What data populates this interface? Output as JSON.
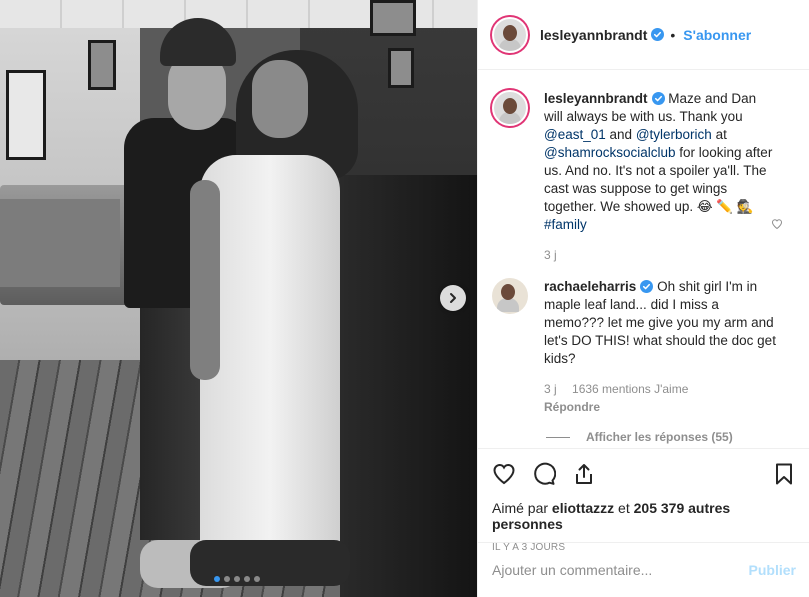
{
  "post": {
    "account": {
      "username": "lesleyannbrandt",
      "verified": true,
      "follow_label": "S'abonner",
      "separator": "•"
    },
    "caption": {
      "username": "lesleyannbrandt",
      "text_1": "Maze and Dan will always be with us. Thank you",
      "mention_1": "@east_01",
      "text_2": "and",
      "mention_2": "@tylerborich",
      "text_3": "at",
      "mention_3": "@shamrocksocialclub",
      "text_4": "for looking after us. And no. It's not a spoiler ya'll. The cast was suppose to get wings together. We showed up. 😂 ✏️ 🕵️",
      "hashtag": "#family",
      "age": "3 j"
    },
    "comment": {
      "username": "rachaeleharris",
      "verified": true,
      "text": "Oh shit girl I'm in maple leaf land... did I miss a memo??? let me give you my arm and let's DO THIS! what should the doc get kids?",
      "age": "3 j",
      "likes": "1636 mentions J'aime",
      "reply_label": "Répondre",
      "view_replies": "Afficher les réponses (55)"
    },
    "engagement": {
      "liked_by_prefix": "Aimé par",
      "liked_by_user": "eliottazzz",
      "liked_by_connector": "et",
      "liked_by_count": "205 379 autres personnes",
      "date": "IL Y A 3 JOURS"
    },
    "composer": {
      "placeholder": "Ajouter un commentaire...",
      "publish_label": "Publier"
    },
    "carousel": {
      "slide_count": 5,
      "active_index": 0
    },
    "colors": {
      "accent": "#3897f0",
      "mention": "#003569",
      "muted": "#8e8e8e",
      "publish_disabled": "#b2dffc"
    },
    "icons": [
      "verified-badge-icon",
      "next-arrow-icon",
      "heart-icon",
      "comment-icon",
      "share-icon",
      "bookmark-icon",
      "heart-small-icon"
    ]
  }
}
